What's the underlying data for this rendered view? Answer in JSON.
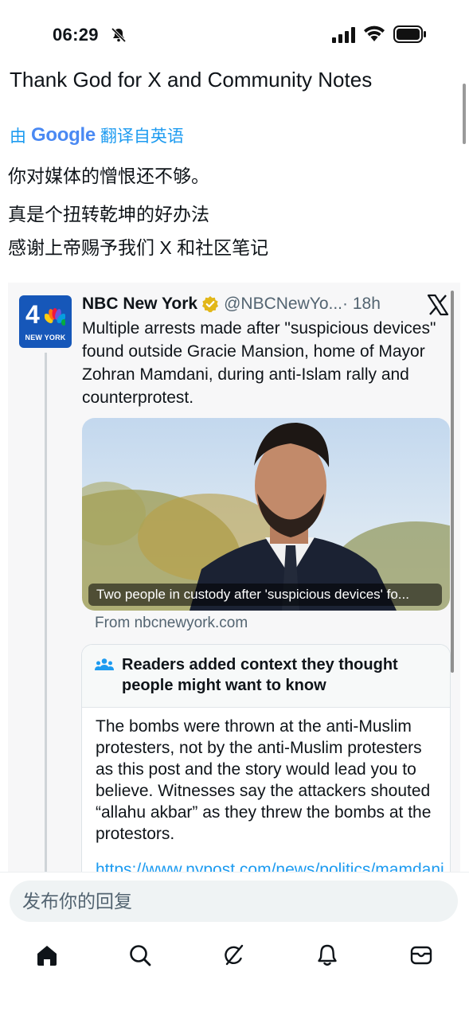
{
  "status_bar": {
    "time": "06:29"
  },
  "post": {
    "text": "Thank God for X and Community Notes",
    "translation": {
      "prefix": "由",
      "provider": "Google",
      "suffix": "翻译自英语",
      "lines": [
        "你对媒体的憎恨还不够。",
        "真是个扭转乾坤的好办法",
        "感谢上帝赐予我们 X 和社区笔记"
      ]
    }
  },
  "embedded_post": {
    "avatar": {
      "channel_number": "4",
      "label": "NEW YORK"
    },
    "author_name": "NBC New York",
    "handle": "@NBCNewYo...",
    "time_ago": "· 18h",
    "text": "Multiple arrests made after \"suspicious devices\" found outside Gracie Mansion, home of Mayor Zohran Mamdani, during anti-Islam rally and counterprotest.",
    "media_caption": "Two people in custody after 'suspicious devices' fo...",
    "source": "From nbcnewyork.com",
    "community_note": {
      "title": "Readers added context they thought people might want to know",
      "body": "The bombs were thrown at the anti-Muslim protesters, not by the anti-Muslim protesters as this post and the story would lead you to believe. Witnesses say the attackers shouted “allahu akbar” as they threw the bombs at the protestors.",
      "link": "https://www.nypost.com/news/politics/mamdani"
    }
  },
  "reply": {
    "placeholder": "发布你的回复"
  },
  "colors": {
    "accent": "#1d9bf0",
    "verified": "#e2b719",
    "avatar_bg": "#1657b9"
  },
  "nav": {
    "items": [
      "home-icon",
      "search-icon",
      "grok-icon",
      "notifications-icon",
      "messages-icon"
    ]
  }
}
